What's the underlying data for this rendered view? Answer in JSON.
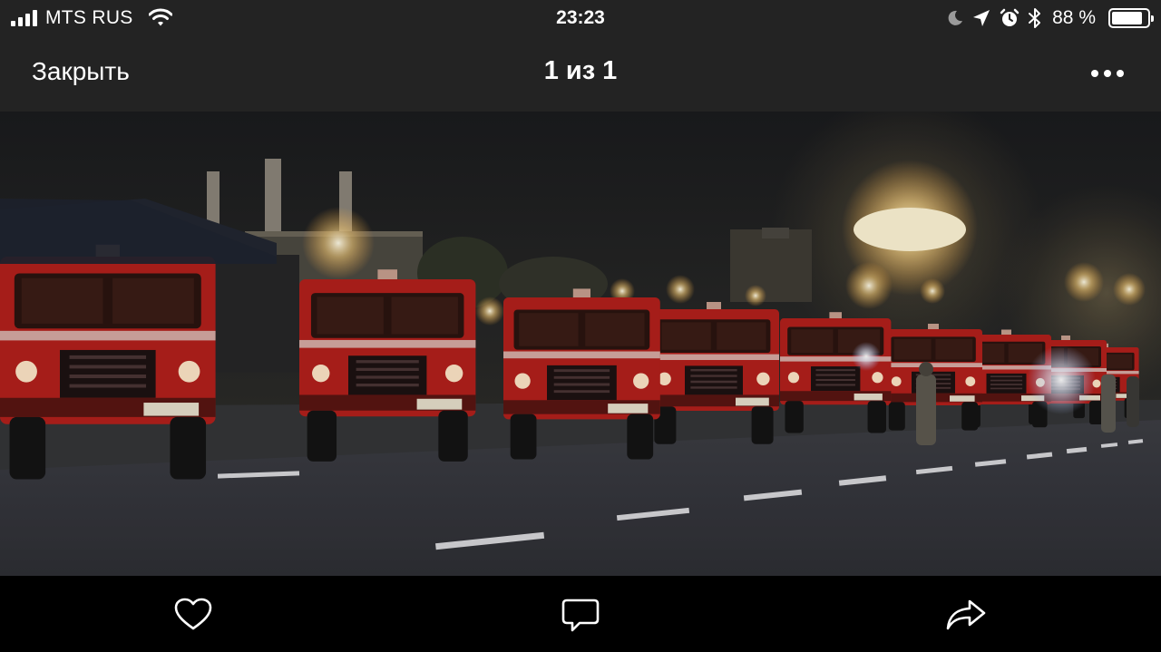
{
  "status_bar": {
    "carrier": "MTS RUS",
    "time": "23:23",
    "battery_percent": "88 %",
    "battery_level": 0.88,
    "icons": [
      "signal-icon",
      "wifi-icon",
      "moon-icon",
      "location-icon",
      "alarm-icon",
      "bluetooth-icon",
      "battery-icon"
    ]
  },
  "nav": {
    "close_label": "Закрыть",
    "counter": "1 из 1",
    "more_icon": "more-icon"
  },
  "photo": {
    "subject": "photo-fire-trucks-night"
  },
  "toolbar": {
    "items": [
      "like-icon",
      "comment-icon",
      "share-icon"
    ]
  },
  "colors": {
    "chrome": "#232323",
    "toolbar": "#000000",
    "text": "#ffffff"
  }
}
